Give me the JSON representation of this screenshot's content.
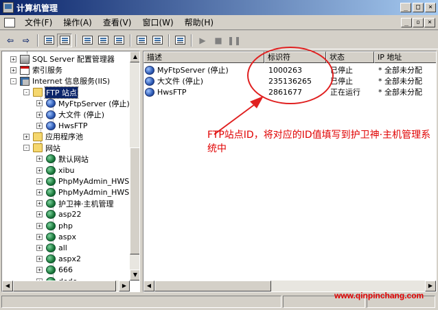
{
  "window": {
    "title": "计算机管理"
  },
  "menu": {
    "items": [
      "文件(F)",
      "操作(A)",
      "查看(V)",
      "窗口(W)",
      "帮助(H)"
    ]
  },
  "tree": {
    "items": [
      {
        "label": "SQL Server 配置管理器",
        "icon": "server-icon"
      },
      {
        "label": "索引服务",
        "icon": "index-icon"
      },
      {
        "label": "Internet 信息服务(IIS)",
        "icon": "iis-icon"
      },
      {
        "label": "FTP 站点",
        "icon": "folder-icon",
        "selected": true
      },
      {
        "label": "MyFtpServer (停止)",
        "icon": "ftp-icon"
      },
      {
        "label": "大文件 (停止)",
        "icon": "ftp-icon"
      },
      {
        "label": "HwsFTP",
        "icon": "ftp-icon"
      },
      {
        "label": "应用程序池",
        "icon": "folder-icon"
      },
      {
        "label": "网站",
        "icon": "folder-icon"
      },
      {
        "label": "默认网站",
        "icon": "globe-icon"
      },
      {
        "label": "xibu",
        "icon": "globe-icon"
      },
      {
        "label": "PhpMyAdmin_HWS",
        "icon": "globe-icon"
      },
      {
        "label": "PhpMyAdmin_HWS",
        "icon": "globe-icon"
      },
      {
        "label": "护卫神·主机管理",
        "icon": "globe-icon"
      },
      {
        "label": "asp22",
        "icon": "globe-icon"
      },
      {
        "label": "php",
        "icon": "globe-icon"
      },
      {
        "label": "aspx",
        "icon": "globe-icon"
      },
      {
        "label": "all",
        "icon": "globe-icon"
      },
      {
        "label": "aspx2",
        "icon": "globe-icon"
      },
      {
        "label": "666",
        "icon": "globe-icon"
      },
      {
        "label": "dede",
        "icon": "globe-icon"
      }
    ]
  },
  "list": {
    "columns": [
      "描述",
      "标识符",
      "状态",
      "IP 地址"
    ],
    "rows": [
      {
        "name": "MyFtpServer (停止)",
        "id": "1000263",
        "status": "已停止",
        "ip": "* 全部未分配"
      },
      {
        "name": "大文件 (停止)",
        "id": "235136265",
        "status": "已停止",
        "ip": "* 全部未分配"
      },
      {
        "name": "HwsFTP",
        "id": "2861677",
        "status": "正在运行",
        "ip": "* 全部未分配"
      }
    ]
  },
  "annotation": {
    "text": "FTP站点ID，将对应的ID值填写到护卫神·主机管理系统中",
    "color": "#e00000"
  },
  "watermark": {
    "text": "www.qinpinchang.com"
  }
}
